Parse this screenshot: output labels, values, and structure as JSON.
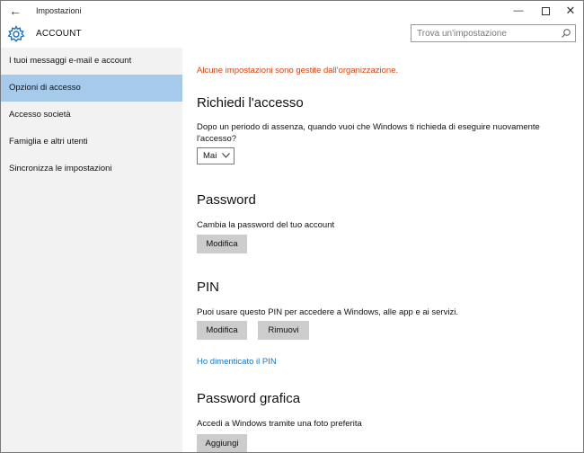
{
  "window": {
    "app_title": "Impostazioni",
    "minimize_glyph": "—",
    "close_glyph": "✕",
    "back_glyph": "←"
  },
  "header": {
    "title": "ACCOUNT",
    "icon": "gear-icon",
    "search_placeholder": "Trova un'impostazione",
    "search_value": ""
  },
  "sidebar": {
    "items": [
      {
        "label": "I tuoi messaggi e-mail e account",
        "active": false
      },
      {
        "label": "Opzioni di accesso",
        "active": true
      },
      {
        "label": "Accesso società",
        "active": false
      },
      {
        "label": "Famiglia e altri utenti",
        "active": false
      },
      {
        "label": "Sincronizza le impostazioni",
        "active": false
      }
    ]
  },
  "content": {
    "org_note": "Alcune impostazioni sono gestite dall'organizzazione.",
    "require_signin": {
      "title": "Richiedi l'accesso",
      "description": "Dopo un periodo di assenza, quando vuoi che Windows ti richieda di eseguire nuovamente l'accesso?",
      "selected": "Mai"
    },
    "password": {
      "title": "Password",
      "description": "Cambia la password del tuo account",
      "change_button": "Modifica"
    },
    "pin": {
      "title": "PIN",
      "description": "Puoi usare questo PIN per accedere a Windows, alle app e ai servizi.",
      "change_button": "Modifica",
      "remove_button": "Rimuovi",
      "forgot_link": "Ho dimenticato il PIN"
    },
    "picture_password": {
      "title": "Password grafica",
      "description": "Accedi a Windows tramite una foto preferita",
      "add_button": "Aggiungi"
    }
  },
  "colors": {
    "accent": "#1476c8",
    "warning": "#d9430f",
    "active_nav": "#a6cbea",
    "button": "#cccccc",
    "sidebar_bg": "#f2f2f2"
  }
}
